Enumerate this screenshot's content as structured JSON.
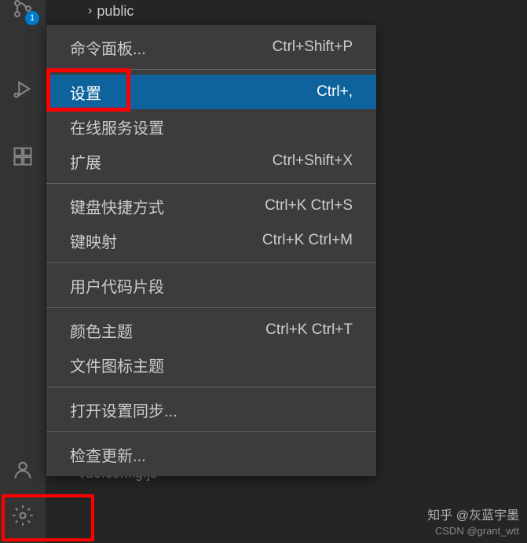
{
  "activityBar": {
    "sourceControlBadge": "1"
  },
  "explorer": {
    "folderName": "public",
    "fileName": "vue.config.js"
  },
  "contextMenu": {
    "items": [
      {
        "label": "命令面板...",
        "shortcut": "Ctrl+Shift+P",
        "selected": false
      },
      {
        "type": "separator"
      },
      {
        "label": "设置",
        "shortcut": "Ctrl+,",
        "selected": true
      },
      {
        "label": "在线服务设置",
        "shortcut": "",
        "selected": false
      },
      {
        "label": "扩展",
        "shortcut": "Ctrl+Shift+X",
        "selected": false
      },
      {
        "type": "separator"
      },
      {
        "label": "键盘快捷方式",
        "shortcut": "Ctrl+K Ctrl+S",
        "selected": false
      },
      {
        "label": "键映射",
        "shortcut": "Ctrl+K Ctrl+M",
        "selected": false
      },
      {
        "type": "separator"
      },
      {
        "label": "用户代码片段",
        "shortcut": "",
        "selected": false
      },
      {
        "type": "separator"
      },
      {
        "label": "颜色主题",
        "shortcut": "Ctrl+K Ctrl+T",
        "selected": false
      },
      {
        "label": "文件图标主题",
        "shortcut": "",
        "selected": false
      },
      {
        "type": "separator"
      },
      {
        "label": "打开设置同步...",
        "shortcut": "",
        "selected": false
      },
      {
        "type": "separator"
      },
      {
        "label": "检查更新...",
        "shortcut": "",
        "selected": false
      }
    ]
  },
  "watermark": {
    "line1": "知乎 @灰蓝宇墨",
    "line2": "CSDN @grant_wtt"
  }
}
